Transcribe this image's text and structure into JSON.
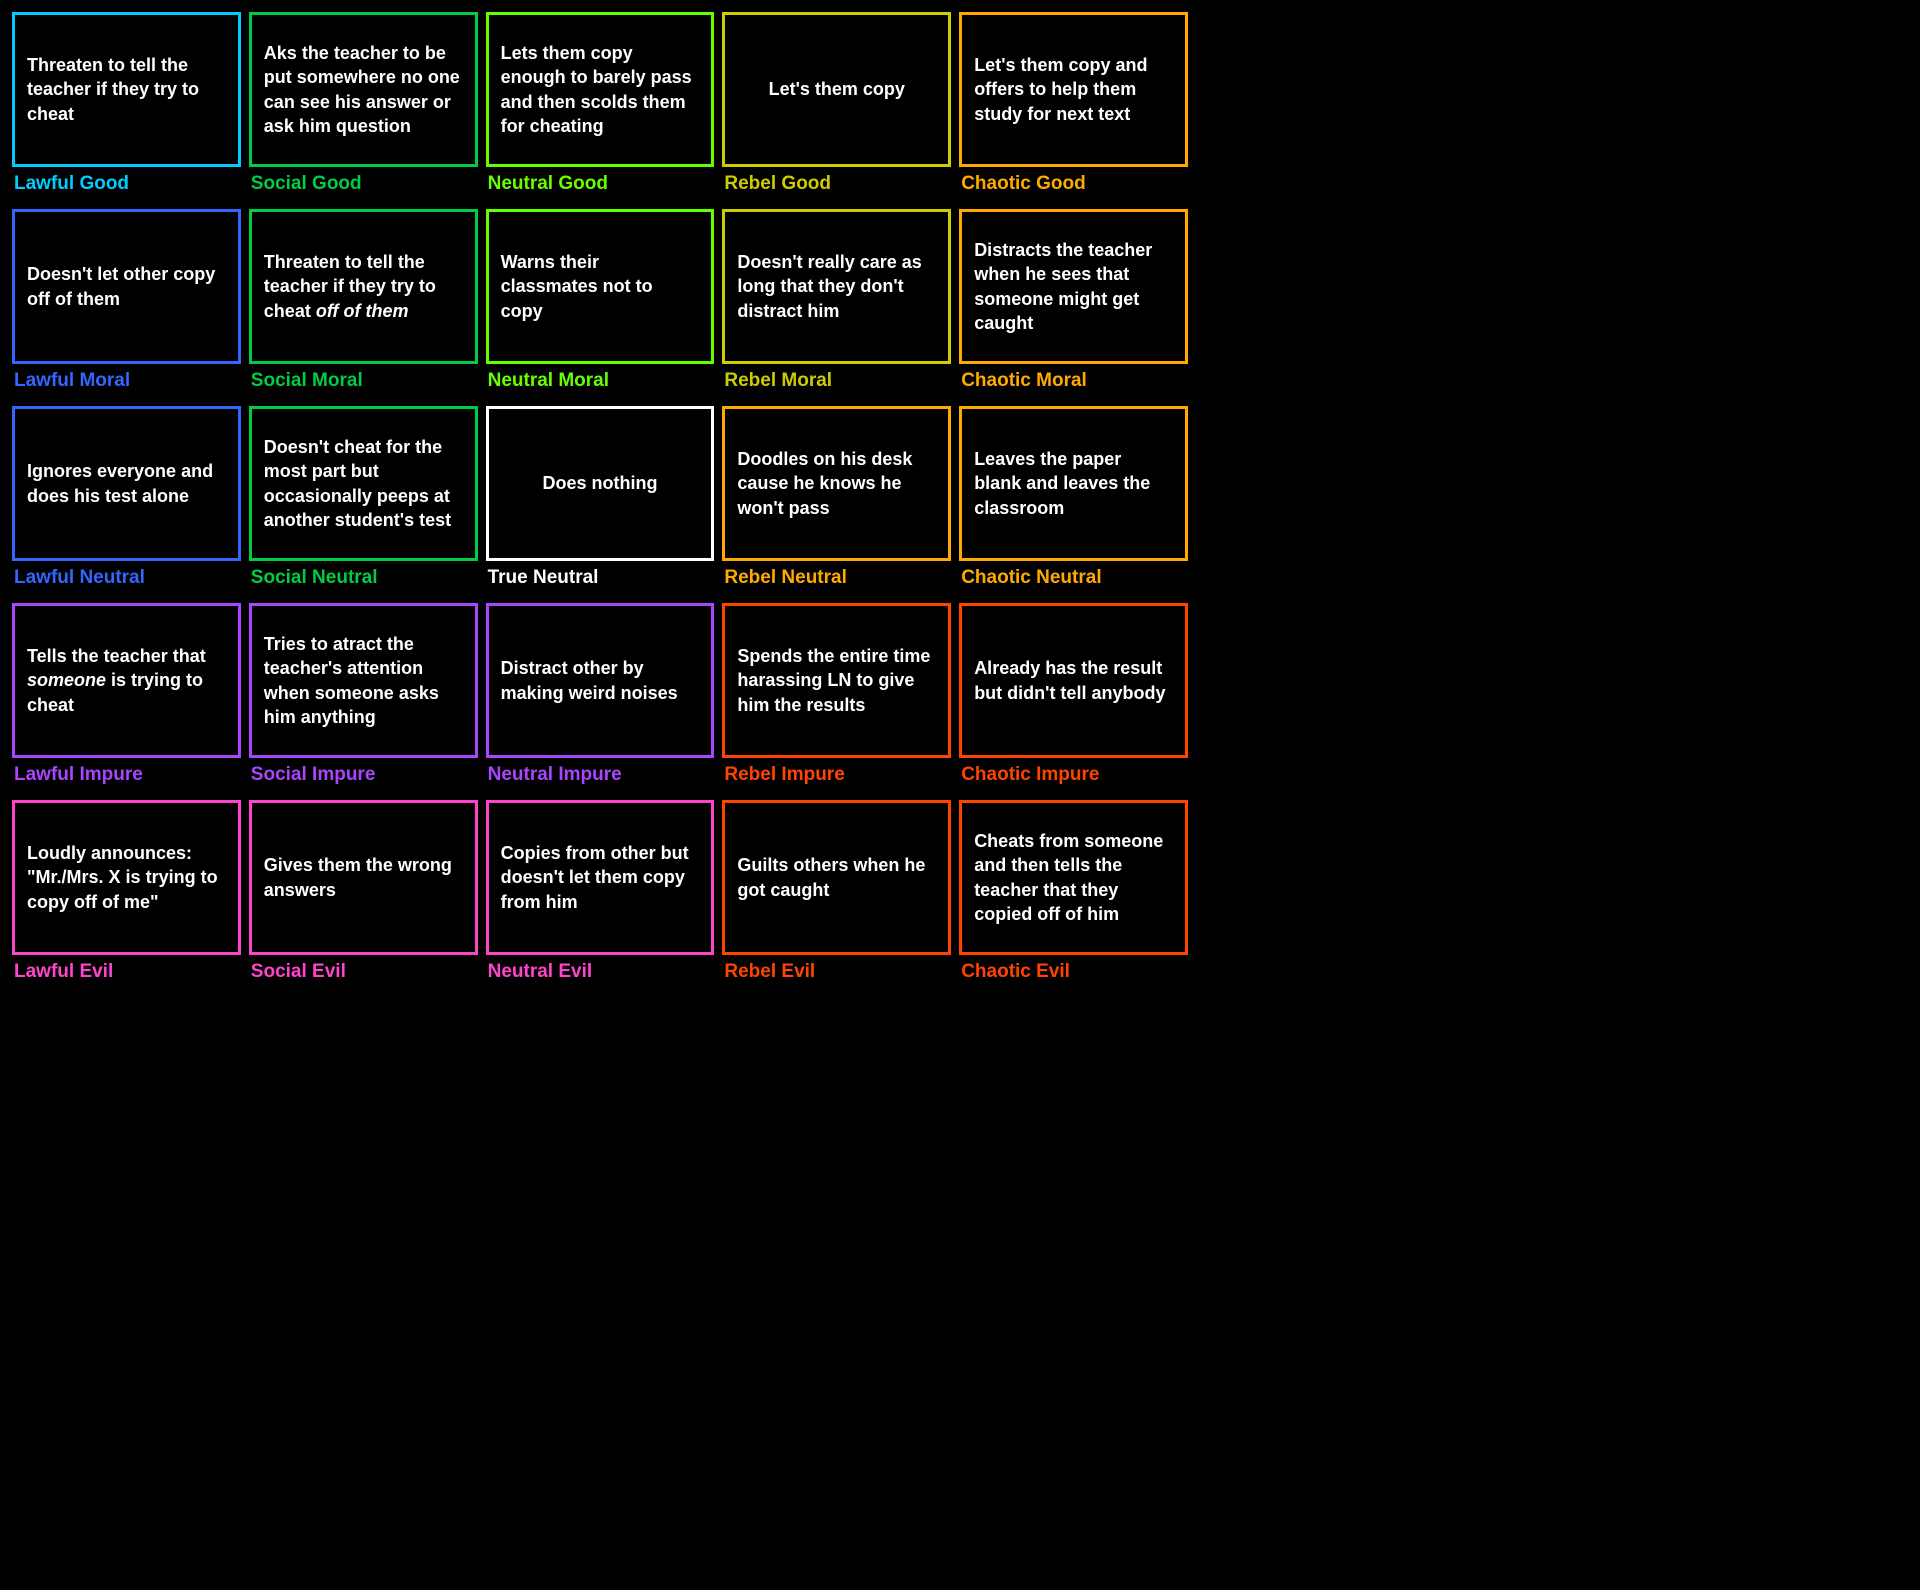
{
  "cells": [
    {
      "row": 1,
      "col": 1,
      "text": "Threaten to tell the teacher if they try to cheat",
      "label": "Lawful Good"
    },
    {
      "row": 1,
      "col": 2,
      "text": "Aks the teacher to be put somewhere no one can see his answer or ask him question",
      "label": "Social Good"
    },
    {
      "row": 1,
      "col": 3,
      "text": "Lets them copy enough to barely pass and then scolds them for cheating",
      "label": "Neutral Good"
    },
    {
      "row": 1,
      "col": 4,
      "text": "Let's them copy",
      "label": "Rebel Good"
    },
    {
      "row": 1,
      "col": 5,
      "text": "Let's them copy and offers to help them study for next text",
      "label": "Chaotic Good"
    },
    {
      "row": 2,
      "col": 1,
      "text": "Doesn't let other copy off of them",
      "label": "Lawful Moral"
    },
    {
      "row": 2,
      "col": 2,
      "text": "Threaten to tell the teacher if they try to cheat off of them",
      "label": "Social Moral",
      "italic_phrase": "off of them"
    },
    {
      "row": 2,
      "col": 3,
      "text": "Warns their classmates not to copy",
      "label": "Neutral Moral"
    },
    {
      "row": 2,
      "col": 4,
      "text": "Doesn't really care as long that they don't distract him",
      "label": "Rebel Moral"
    },
    {
      "row": 2,
      "col": 5,
      "text": "Distracts the teacher when he sees that someone might get caught",
      "label": "Chaotic Moral"
    },
    {
      "row": 3,
      "col": 1,
      "text": "Ignores everyone and does his test alone",
      "label": "Lawful Neutral"
    },
    {
      "row": 3,
      "col": 2,
      "text": "Doesn't cheat for the most part but occasionally peeps at another student's test",
      "label": "Social Neutral"
    },
    {
      "row": 3,
      "col": 3,
      "text": "Does nothing",
      "label": "True Neutral",
      "black_card": true
    },
    {
      "row": 3,
      "col": 4,
      "text": "Doodles on his desk cause he knows he won't pass",
      "label": "Rebel Neutral"
    },
    {
      "row": 3,
      "col": 5,
      "text": "Leaves the paper blank and leaves the classroom",
      "label": "Chaotic Neutral"
    },
    {
      "row": 4,
      "col": 1,
      "text": "Tells the teacher that someone is trying to cheat",
      "label": "Lawful Impure",
      "italic_phrase": "someone"
    },
    {
      "row": 4,
      "col": 2,
      "text": "Tries to atract the teacher's attention when someone asks him anything",
      "label": "Social Impure"
    },
    {
      "row": 4,
      "col": 3,
      "text": "Distract other by making weird noises",
      "label": "Neutral Impure"
    },
    {
      "row": 4,
      "col": 4,
      "text": "Spends the entire time harassing LN to give him the results",
      "label": "Rebel Impure"
    },
    {
      "row": 4,
      "col": 5,
      "text": "Already has the result but didn't tell anybody",
      "label": "Chaotic Impure"
    },
    {
      "row": 5,
      "col": 1,
      "text": "Loudly announces: \"Mr./Mrs. X is trying to copy off of me\"",
      "label": "Lawful Evil"
    },
    {
      "row": 5,
      "col": 2,
      "text": "Gives them the wrong answers",
      "label": "Social Evil"
    },
    {
      "row": 5,
      "col": 3,
      "text": "Copies from other but doesn't let them copy from him",
      "label": "Neutral Evil"
    },
    {
      "row": 5,
      "col": 4,
      "text": "Guilts others when he got caught",
      "label": "Rebel Evil"
    },
    {
      "row": 5,
      "col": 5,
      "text": "Cheats from someone and then tells the teacher that they copied off of him",
      "label": "Chaotic Evil"
    }
  ]
}
